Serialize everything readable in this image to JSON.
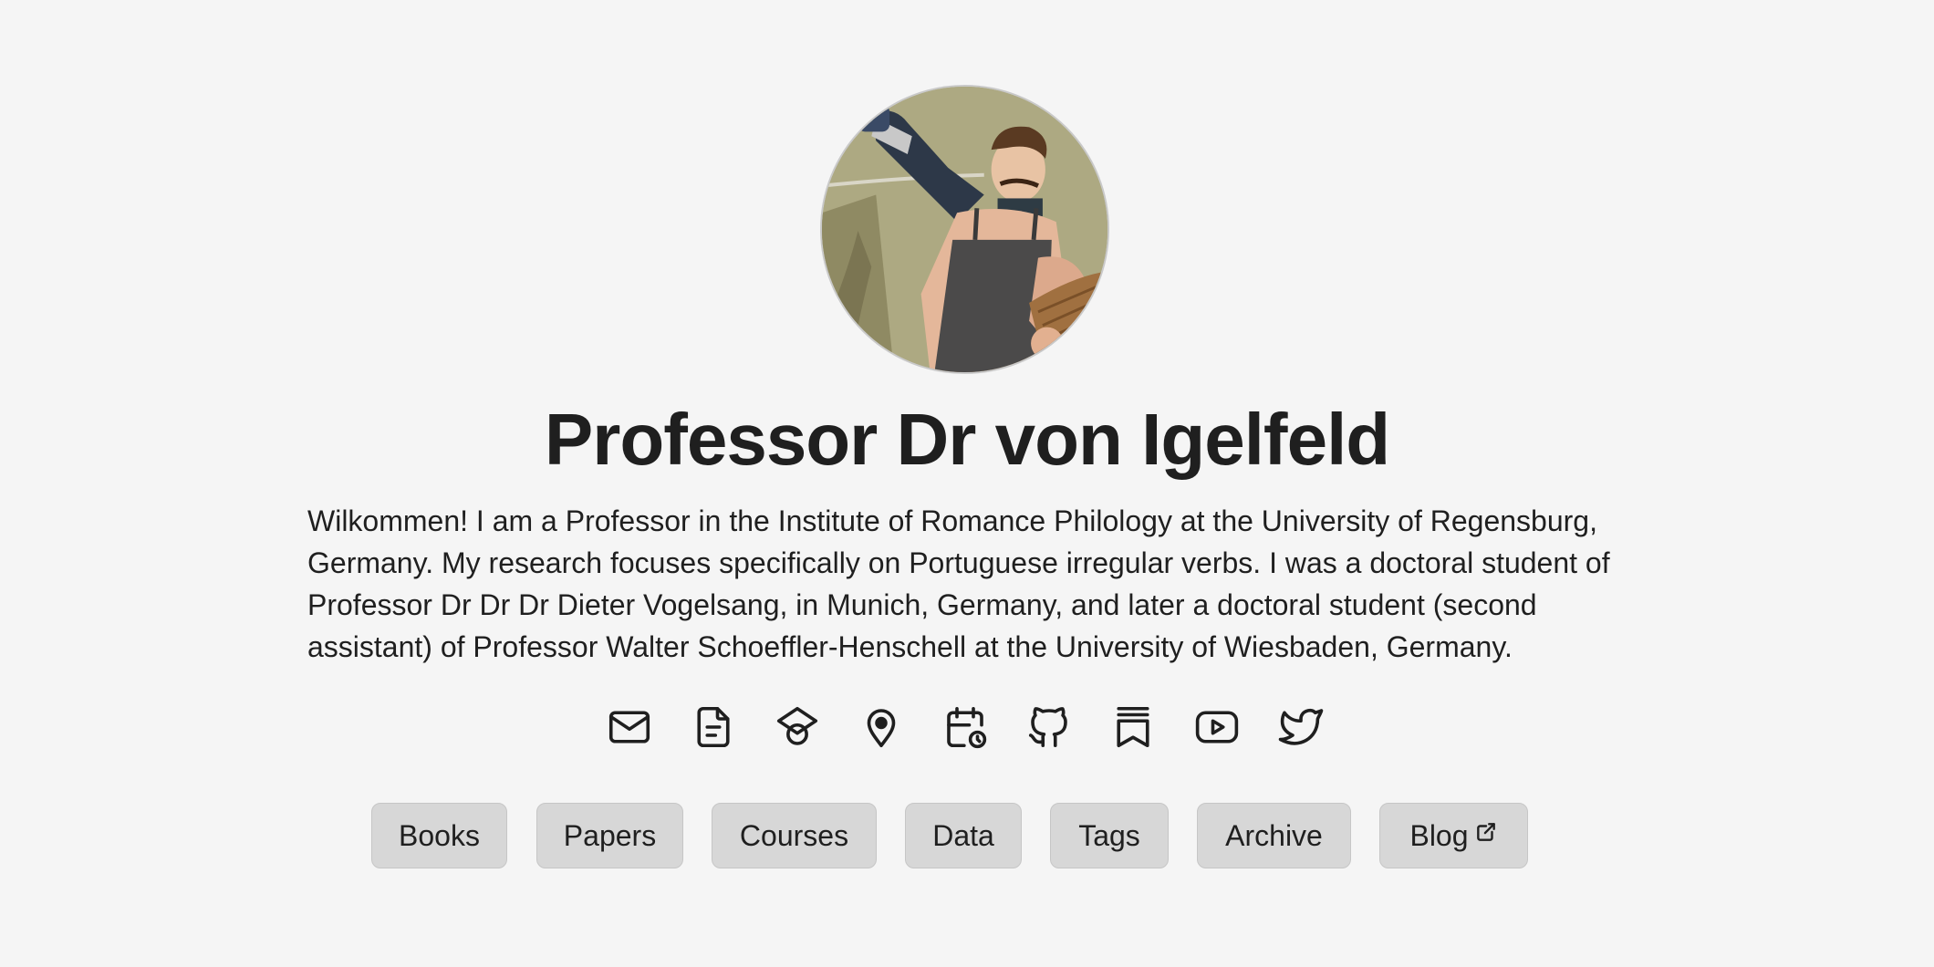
{
  "profile": {
    "name": "Professor Dr von Igelfeld",
    "bio": "Wilkommen! I am a Professor in the Institute of Romance Philology at the University of Regensburg, Germany. My research focuses specifically on Portuguese irregular verbs. I was a doctoral student of Professor Dr Dr Dr Dieter Vogelsang, in Munich, Germany, and later a doctoral student (second assistant) of Professor Walter Schoeffler-Henschell at the University of Wiesbaden, Germany."
  },
  "social_icons": [
    "email-icon",
    "cv-document-icon",
    "graduation-cap-icon",
    "location-pin-icon",
    "calendar-icon",
    "github-icon",
    "bookmark-stack-icon",
    "youtube-icon",
    "twitter-icon"
  ],
  "nav": {
    "books": "Books",
    "papers": "Papers",
    "courses": "Courses",
    "data": "Data",
    "tags": "Tags",
    "archive": "Archive",
    "blog": "Blog"
  },
  "colors": {
    "background": "#f5f5f5",
    "text": "#1f1f1f",
    "button_bg": "#d7d7d7"
  }
}
